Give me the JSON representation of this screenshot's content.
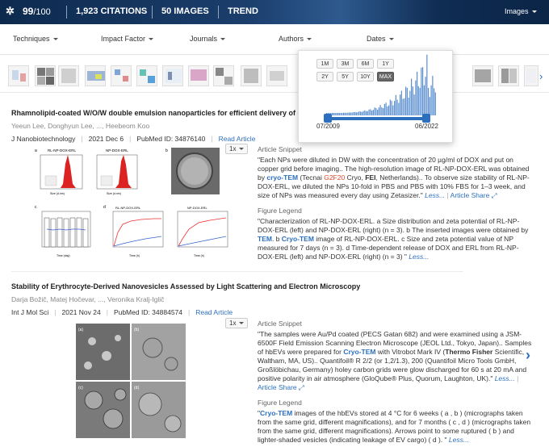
{
  "topbar": {
    "score": "99",
    "score_total": "/100",
    "citations": "1,923 CITATIONS",
    "images": "50 IMAGES",
    "trend": "TREND",
    "images_menu": "Images"
  },
  "filters": [
    "Techniques",
    "Impact Factor",
    "Journals",
    "Authors",
    "Dates"
  ],
  "datepicker": {
    "row1": [
      "1M",
      "3M",
      "6M",
      "1Y"
    ],
    "row2": [
      "2Y",
      "5Y",
      "10Y",
      "MAX"
    ],
    "active": "MAX",
    "start_label": "07/2009",
    "end_label": "06/2022",
    "accent": "#2c6fbf"
  },
  "articles": [
    {
      "title": "Rhamnolipid-coated W/O/W double emulsion nanoparticles for efficient delivery of doxorubicin/erl",
      "authors": "Yeeun Lee, Donghyun Lee, ..., Heebeom Koo",
      "journal": "J Nanobiotechnology",
      "date": "2021 Dec 6",
      "pmid": "PubMed ID: 34876140",
      "read": "Read Article",
      "zoom": "1x",
      "fig": {
        "l_a": "a",
        "l_b": "b",
        "l_c": "c",
        "l_d": "d",
        "p1": "RL-NP-DOX-ERL",
        "p2": "NP-DOX-ERL",
        "p3": "RL-NP-DOX-ERL",
        "p4": "NP-DOX-ERL",
        "xsize": "Size (d.nm)",
        "xtime": "Time (day)",
        "xtimeh": "Time (h)"
      },
      "snippet_h": "Article Snippet",
      "snippet": [
        "\"Each NPs were diluted in DW with the concentration of 20 µg/ml of DOX and put on copper grid before imaging.. The high-resolution image of RL-NP-DOX-ERL was obtained by ",
        "cryo-TEM",
        " (Tecnai ",
        "G2F20",
        " Cryo, ",
        "FEI",
        ", Netherlands).. To observe size stability of RL-NP-DOX-ERL, we diluted the NPs 10-fold in PBS and PBS with 10% FBS for 1–3 week, and size of NPs was measured every day using Zetasizer.\" ",
        "Less...",
        "|",
        "Article Share"
      ],
      "legend_h": "Figure Legend",
      "legend": [
        "\"Characterization of RL-NP-DOX-ERL. a Size distribution and zeta potential of RL-NP-DOX-ERL (left) and NP-DOX-ERL (right) (n = 3). b The inserted images were obtained by ",
        "TEM",
        ". b ",
        "Cryo-TEM",
        " image of RL-NP-DOX-ERL. c Size and zeta potential value of NP measured for 7 days (n = 3). d Time-dependent release of DOX and ERL from RL-NP-DOX-ERL (left) and NP-DOX-ERL (right) (n = 3) \" ",
        "Less..."
      ]
    },
    {
      "title": "Stability of Erythrocyte-Derived Nanovesicles Assessed by Light Scattering and Electron Microscopy",
      "authors": "Darja Božič, Matej Hočevar, ..., Veronika Kralj-Iglič",
      "journal": "Int J Mol Sci",
      "date": "2021 Nov 24",
      "pmid": "PubMed ID: 34884574",
      "read": "Read Article",
      "zoom": "1x",
      "fig": {
        "la": "(a)",
        "lb": "(b)",
        "lc": "(c)",
        "ld": "(d)"
      },
      "snippet_h": "Article Snippet",
      "snippet": [
        "\"The samples were Au/Pd coated (PECS Gatan 682) and were examined using a JSM-6500F Field Emission Scanning Electron Microscope (JEOL Ltd., Tokyo, Japan).. Samples of hbEVs were prepared for ",
        "Cryo-TEM",
        " with Vitrobot Mark IV (",
        "Thermo Fisher",
        " Scientific, Waltham, MA, US).. Quantifoil® R 2/2 (or 1,2/1.3), 200 (Quantifoil Micro Tools GmbH, Großlöbichau, Germany) holey carbon grids were glow discharged for 60 s at 20 mA and positive polarity in air atmosphere (GloQube® Plus, Quorum, Laughton, UK).\" ",
        "Less...",
        "|",
        "Article Share"
      ],
      "legend_h": "Figure Legend",
      "legend": [
        "\"",
        "Cryo-TEM",
        " images of the hbEVs stored at 4 °C for 6 weeks ( a , b ) (micrographs taken from the same grid, different magnifications), and for 7 months ( c , d ) (micrographs taken from the same grid, different magnifications). Arrows point to some ruptured ( b ) and lighter-shaded vesicles (indicating leakage of EV cargo) ( d ). \" ",
        "Less..."
      ]
    }
  ]
}
